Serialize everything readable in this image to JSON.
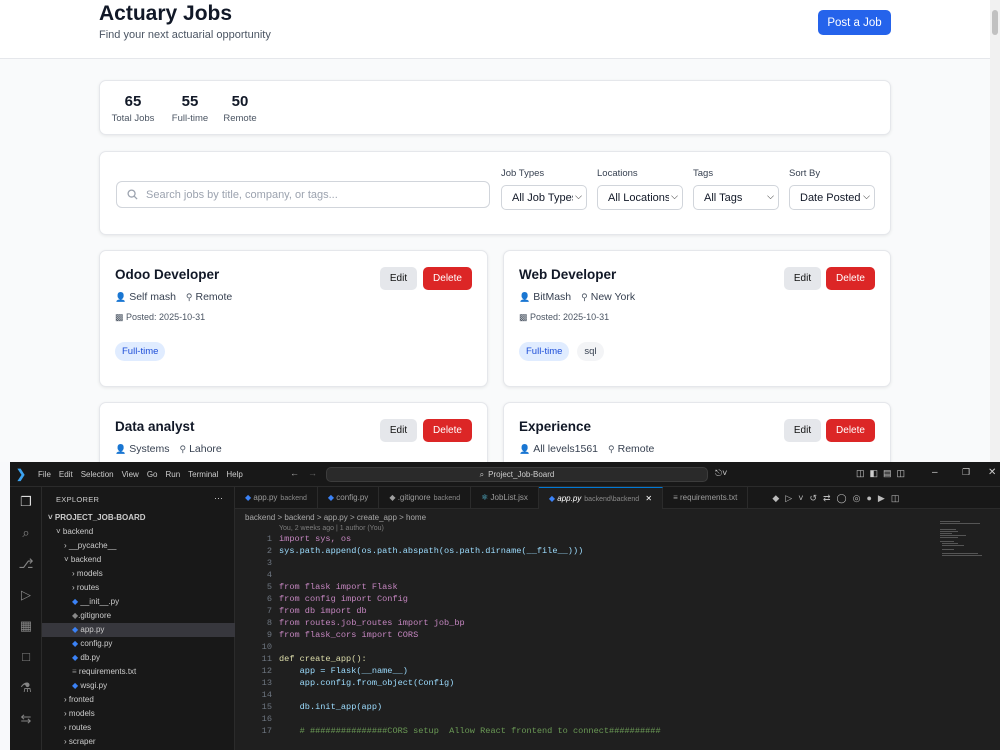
{
  "header": {
    "title": "Actuary Jobs",
    "subtitle": "Find your next actuarial opportunity",
    "post_button": "Post a Job"
  },
  "stats": [
    {
      "value": "65",
      "label": "Total Jobs"
    },
    {
      "value": "55",
      "label": "Full-time"
    },
    {
      "value": "50",
      "label": "Remote"
    }
  ],
  "filters": {
    "search_placeholder": "Search jobs by title, company, or tags...",
    "job_types": {
      "label": "Job Types",
      "value": "All Job Types"
    },
    "locations": {
      "label": "Locations",
      "value": "All Locations"
    },
    "tags": {
      "label": "Tags",
      "value": "All Tags"
    },
    "sort": {
      "label": "Sort By",
      "value": "Date Posted"
    }
  },
  "jobs": [
    {
      "title": "Odoo Developer",
      "company": "Self mash",
      "location": "Remote",
      "posted": "Posted: 2025-10-31",
      "tags": [
        "Full-time"
      ],
      "edit": "Edit",
      "delete": "Delete"
    },
    {
      "title": "Web Developer",
      "company": "BitMash",
      "location": "New York",
      "posted": "Posted: 2025-10-31",
      "tags": [
        "Full-time",
        "sql"
      ],
      "edit": "Edit",
      "delete": "Delete"
    },
    {
      "title": "Data analyst",
      "company": "Systems",
      "location": "Lahore",
      "edit": "Edit",
      "delete": "Delete"
    },
    {
      "title": "Experience",
      "company": "All levels1561",
      "location": "Remote",
      "edit": "Edit",
      "delete": "Delete"
    }
  ],
  "vscode": {
    "menu": [
      "File",
      "Edit",
      "Selection",
      "View",
      "Go",
      "Run",
      "Terminal",
      "Help"
    ],
    "command_center": "Project_Job-Board",
    "explorer_title": "EXPLORER",
    "tree": [
      {
        "label": "PROJECT_JOB-BOARD",
        "bold": true
      },
      {
        "label": "backend",
        "arrow": "v"
      },
      {
        "label": "__pycache__",
        "arrow": ">"
      },
      {
        "label": "backend",
        "arrow": "v"
      },
      {
        "label": "models",
        "arrow": ">"
      },
      {
        "label": "routes",
        "arrow": ">"
      },
      {
        "label": "__init__.py"
      },
      {
        "label": ".gitignore"
      },
      {
        "label": "app.py",
        "selected": true
      },
      {
        "label": "config.py"
      },
      {
        "label": "db.py"
      },
      {
        "label": "requirements.txt"
      },
      {
        "label": "wsgi.py"
      },
      {
        "label": "fronted",
        "arrow": ">"
      },
      {
        "label": "models",
        "arrow": ">"
      },
      {
        "label": "routes",
        "arrow": ">"
      },
      {
        "label": "scraper",
        "arrow": ">"
      }
    ],
    "tabs": [
      {
        "name": "app.py",
        "dir": "backend"
      },
      {
        "name": "config.py",
        "dir": ""
      },
      {
        "name": ".gitignore",
        "dir": "backend"
      },
      {
        "name": "JobList.jsx",
        "dir": ""
      },
      {
        "name": "app.py",
        "dir": "backend\\backend",
        "active": true
      },
      {
        "name": "requirements.txt",
        "dir": ""
      }
    ],
    "breadcrumb": "backend > backend > app.py > create_app > home",
    "blame": "You, 2 weeks ago | 1 author (You)",
    "line_numbers": [
      "1",
      "2",
      "3",
      "4",
      "5",
      "6",
      "7",
      "8",
      "9",
      "10",
      "11",
      "12",
      "13",
      "14",
      "15",
      "16",
      "17"
    ],
    "code": [
      "import sys, os",
      "sys.path.append(os.path.abspath(os.path.dirname(__file__)))",
      "",
      "",
      "from flask import Flask",
      "from config import Config",
      "from db import db",
      "from routes.job_routes import job_bp",
      "from flask_cors import CORS",
      "",
      "def create_app():",
      "    app = Flask(__name__)",
      "    app.config.from_object(Config)",
      "",
      "    db.init_app(app)",
      "",
      "    # ###############CORS setup  Allow React frontend to connect##########"
    ]
  }
}
